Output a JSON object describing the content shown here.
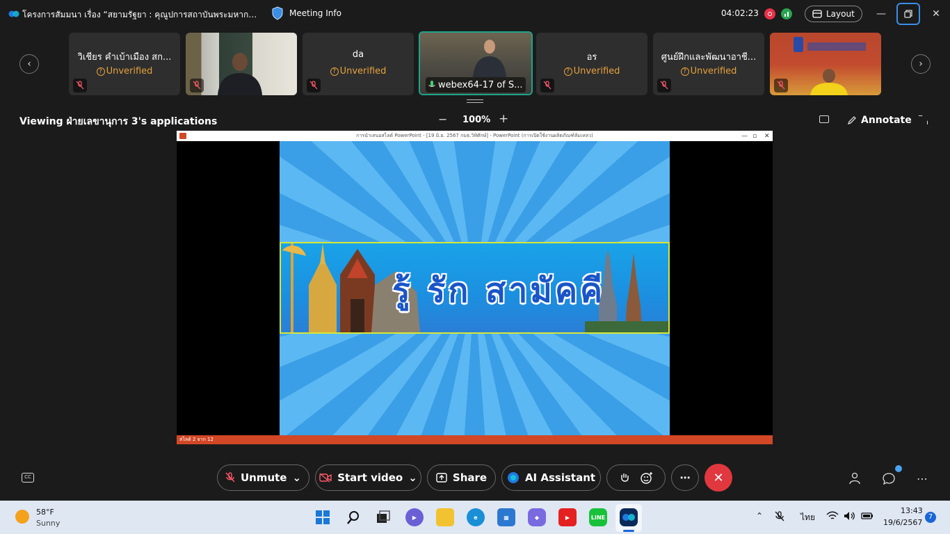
{
  "title_bar": {
    "title": "โครงการสัมมนา เรื่อง “สยามรัฐยา : คุณูปการสถาบันพระมหากษัตริย์...",
    "meeting_info": "Meeting Info",
    "timer": "04:02:23",
    "layout_label": "Layout"
  },
  "participants": [
    {
      "name": "วิเชียร  คำเบ้าเมือง  สก...",
      "status": "Unverified",
      "video": false
    },
    {
      "name": "",
      "status": "",
      "video": true
    },
    {
      "name": "da",
      "status": "Unverified",
      "video": false
    },
    {
      "name": "webex64-17 of  S...",
      "status": "",
      "video": true,
      "active": true
    },
    {
      "name": "อร",
      "status": "Unverified",
      "video": false
    },
    {
      "name": "ศูนย์ฝึกและพัฒนาอาชี...",
      "status": "Unverified",
      "video": false
    },
    {
      "name": "",
      "status": "",
      "video": true
    }
  ],
  "share_bar": {
    "viewing_text": "Viewing ฝ่ายเลขานุการ 3's applications",
    "zoom": "100%",
    "annotate_label": "Annotate"
  },
  "shared_window": {
    "title": "การนำเสนอสไลด์ PowerPoint - [19 มิ.ย. 2567 กมธ.วิทิศักษ์] - PowerPoint (การเปิดใช้งานผลิตภัณฑ์ล้มเหลว)",
    "slide_text": "รู้  รัก  สามัคคี",
    "status_text": "สไลด์ 2 จาก 12"
  },
  "controls": {
    "unmute": "Unmute",
    "start_video": "Start video",
    "share": "Share",
    "ai_assistant": "AI Assistant"
  },
  "taskbar": {
    "temperature": "58°F",
    "condition": "Sunny",
    "language": "ไทย",
    "time": "13:43",
    "date": "19/6/2567",
    "notifications": "7"
  },
  "colors": {
    "end_call": "#e0383e",
    "active_tile_border": "#1fa38c",
    "unverified": "#e6a23c"
  }
}
